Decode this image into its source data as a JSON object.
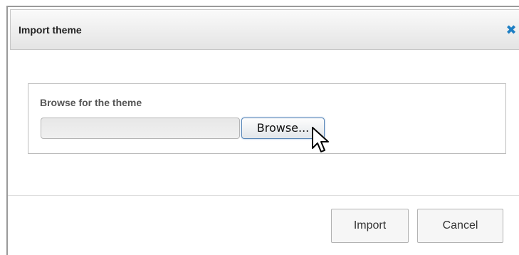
{
  "dialog": {
    "title": "Import theme",
    "close_icon": "close-icon",
    "section_label": "Browse for the theme",
    "file_input_value": "",
    "browse_label": "Browse...",
    "import_label": "Import",
    "cancel_label": "Cancel"
  },
  "colors": {
    "accent": "#1e7fc4",
    "title_text": "#222222",
    "label_text": "#555555"
  }
}
